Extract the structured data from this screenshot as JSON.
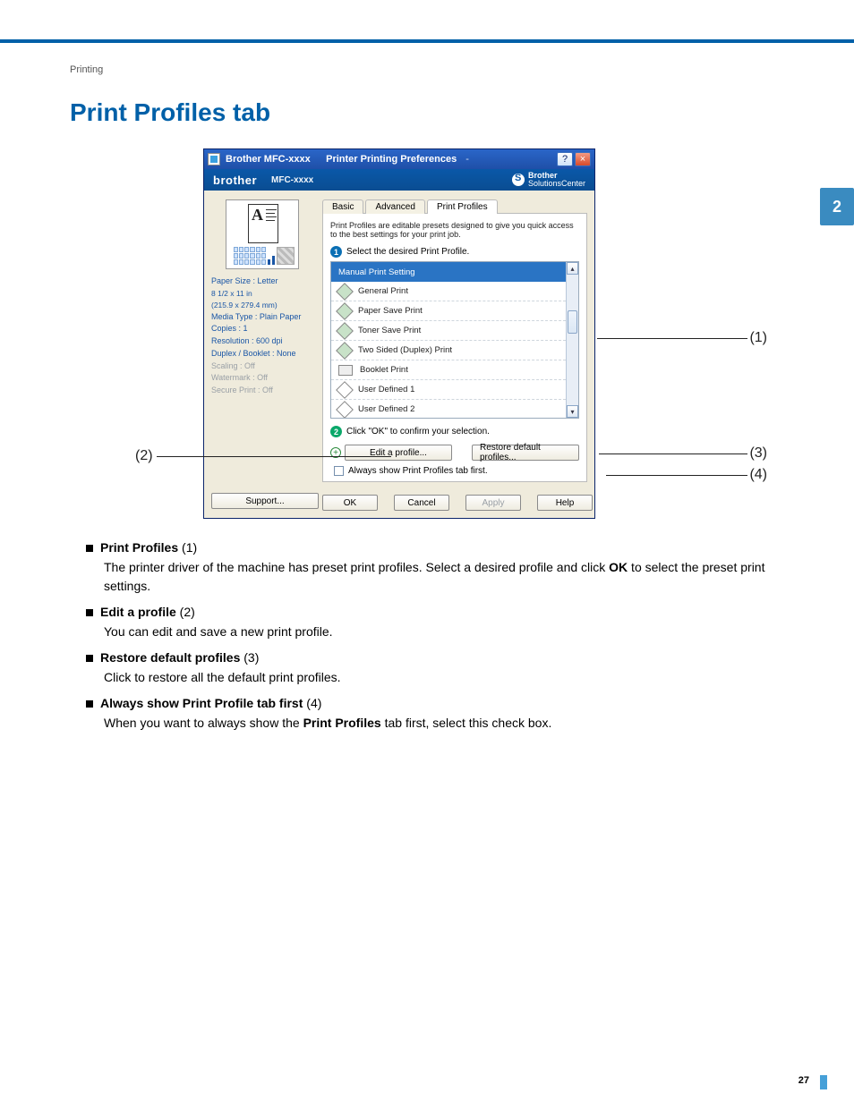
{
  "page": {
    "breadcrumb": "Printing",
    "heading": "Print Profiles tab",
    "chapter_number": "2",
    "page_number": "27"
  },
  "callouts": {
    "c1": "(1)",
    "c2": "(2)",
    "c3": "(3)",
    "c4": "(4)"
  },
  "dialog": {
    "title_product": "Brother MFC-xxxx",
    "title_section": "Printer Printing Preferences",
    "help_glyph": "?",
    "close_glyph": "×",
    "brand_logo": "brother",
    "brand_model": "MFC-xxxx",
    "solutions_center_line1": "Brother",
    "solutions_center_line2": "SolutionsCenter",
    "left_info": {
      "paper_size": "Paper Size : Letter",
      "paper_dim": "8 1/2 x 11 in",
      "paper_mm": "(215.9 x 279.4 mm)",
      "media_type": "Media Type : Plain Paper",
      "copies": "Copies : 1",
      "resolution": "Resolution : 600 dpi",
      "duplex": "Duplex / Booklet : None",
      "scaling": "Scaling : Off",
      "watermark": "Watermark : Off",
      "secure": "Secure Print : Off",
      "support_btn": "Support..."
    },
    "tabs": {
      "basic": "Basic",
      "advanced": "Advanced",
      "print_profiles": "Print Profiles"
    },
    "panel": {
      "description": "Print Profiles are editable presets designed to give you quick access to the best settings for your print job.",
      "step1": "Select the desired Print Profile.",
      "step2": "Click \"OK\" to confirm your selection.",
      "profiles": [
        "Manual Print Setting",
        "General Print",
        "Paper Save Print",
        "Toner Save Print",
        "Two Sided (Duplex) Print",
        "Booklet Print",
        "User Defined 1",
        "User Defined 2"
      ],
      "edit_btn": "Edit a profile...",
      "restore_btn": "Restore default profiles...",
      "always_show": "Always show Print Profiles tab first."
    },
    "buttons": {
      "ok": "OK",
      "cancel": "Cancel",
      "apply": "Apply",
      "help": "Help"
    }
  },
  "body": {
    "items": [
      {
        "title_bold": "Print Profiles",
        "title_suffix": " (1)",
        "para_before": "The printer driver of the machine has preset print profiles. Select a desired profile and click ",
        "ok_word": "OK",
        "para_after": " to select the preset print settings."
      },
      {
        "title_bold": "Edit a profile",
        "title_suffix": " (2)",
        "para": "You can edit and save a new print profile."
      },
      {
        "title_bold": "Restore default profiles",
        "title_suffix": " (3)",
        "para": "Click to restore all the default print profiles."
      },
      {
        "title_bold": "Always show Print Profile tab first",
        "title_suffix": " (4)",
        "para_before": "When you want to always show the ",
        "bold_mid": "Print Profiles",
        "para_after": " tab first, select this check box."
      }
    ]
  }
}
